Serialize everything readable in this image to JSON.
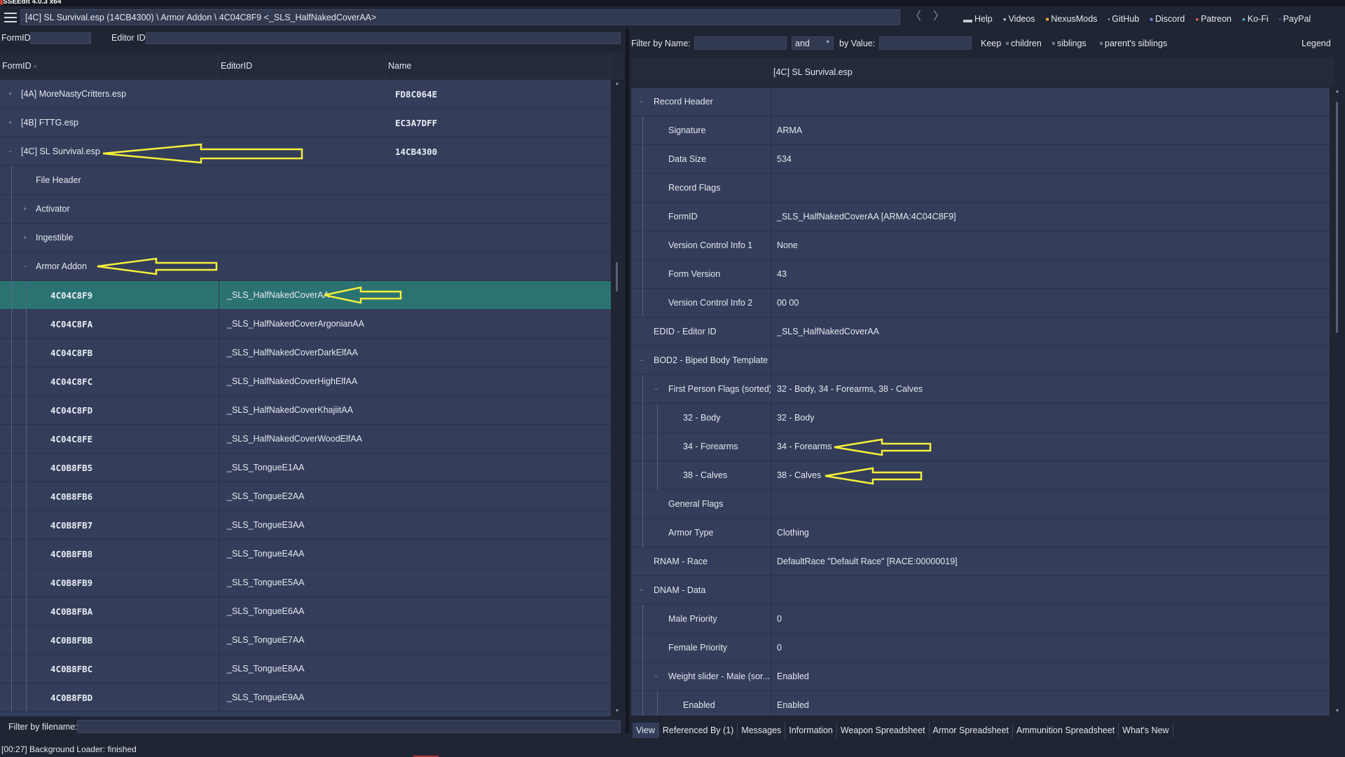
{
  "app": {
    "title": "SSEEdit 4.0.3 x64"
  },
  "toolbar": {
    "path": "[4C] SL Survival.esp (14CB4300) \\ Armor Addon \\ 4C04C8F9 <_SLS_HalfNakedCoverAA>",
    "back_glyph": "〈",
    "forward_glyph": "〉",
    "links": [
      {
        "label": "Help",
        "icon": "book-icon"
      },
      {
        "label": "Videos",
        "icon": "video-icon"
      },
      {
        "label": "NexusMods",
        "icon": "nexus-icon"
      },
      {
        "label": "GitHub",
        "icon": "github-icon"
      },
      {
        "label": "Discord",
        "icon": "discord-icon"
      },
      {
        "label": "Patreon",
        "icon": "patreon-icon"
      },
      {
        "label": "Ko-Fi",
        "icon": "kofi-icon"
      },
      {
        "label": "PayPal",
        "icon": "paypal-icon"
      }
    ]
  },
  "left": {
    "formid_label": "FormID",
    "editorid_label": "Editor ID",
    "formid_value": "",
    "editorid_value": "",
    "columns": {
      "formid": "FormID",
      "editorid": "EditorID",
      "name": "Name"
    },
    "rows": [
      {
        "level": 0,
        "expander": "+",
        "formid": "[4A] MoreNastyCritters.esp",
        "editorid": "",
        "name": "FD8C064E"
      },
      {
        "level": 0,
        "expander": "+",
        "formid": "[4B] FTTG.esp",
        "editorid": "",
        "name": "EC3A7DFF"
      },
      {
        "level": 0,
        "expander": "−",
        "formid": "[4C] SL Survival.esp",
        "editorid": "",
        "name": "14CB4300"
      },
      {
        "level": 1,
        "expander": "",
        "formid": "File Header",
        "editorid": "",
        "name": ""
      },
      {
        "level": 1,
        "expander": "+",
        "formid": "Activator",
        "editorid": "",
        "name": ""
      },
      {
        "level": 1,
        "expander": "+",
        "formid": "Ingestible",
        "editorid": "",
        "name": ""
      },
      {
        "level": 1,
        "expander": "−",
        "formid": "Armor Addon",
        "editorid": "",
        "name": ""
      },
      {
        "level": 2,
        "expander": "",
        "formid": "4C04C8F9",
        "editorid": "_SLS_HalfNakedCoverAA",
        "name": "",
        "selected": true
      },
      {
        "level": 2,
        "expander": "",
        "formid": "4C04C8FA",
        "editorid": "_SLS_HalfNakedCoverArgonianAA",
        "name": ""
      },
      {
        "level": 2,
        "expander": "",
        "formid": "4C04C8FB",
        "editorid": "_SLS_HalfNakedCoverDarkElfAA",
        "name": ""
      },
      {
        "level": 2,
        "expander": "",
        "formid": "4C04C8FC",
        "editorid": "_SLS_HalfNakedCoverHighElfAA",
        "name": ""
      },
      {
        "level": 2,
        "expander": "",
        "formid": "4C04C8FD",
        "editorid": "_SLS_HalfNakedCoverKhajiitAA",
        "name": ""
      },
      {
        "level": 2,
        "expander": "",
        "formid": "4C04C8FE",
        "editorid": "_SLS_HalfNakedCoverWoodElfAA",
        "name": ""
      },
      {
        "level": 2,
        "expander": "",
        "formid": "4C0B8FB5",
        "editorid": "_SLS_TongueE1AA",
        "name": ""
      },
      {
        "level": 2,
        "expander": "",
        "formid": "4C0B8FB6",
        "editorid": "_SLS_TongueE2AA",
        "name": ""
      },
      {
        "level": 2,
        "expander": "",
        "formid": "4C0B8FB7",
        "editorid": "_SLS_TongueE3AA",
        "name": ""
      },
      {
        "level": 2,
        "expander": "",
        "formid": "4C0B8FB8",
        "editorid": "_SLS_TongueE4AA",
        "name": ""
      },
      {
        "level": 2,
        "expander": "",
        "formid": "4C0B8FB9",
        "editorid": "_SLS_TongueE5AA",
        "name": ""
      },
      {
        "level": 2,
        "expander": "",
        "formid": "4C0B8FBA",
        "editorid": "_SLS_TongueE6AA",
        "name": ""
      },
      {
        "level": 2,
        "expander": "",
        "formid": "4C0B8FBB",
        "editorid": "_SLS_TongueE7AA",
        "name": ""
      },
      {
        "level": 2,
        "expander": "",
        "formid": "4C0B8FBC",
        "editorid": "_SLS_TongueE8AA",
        "name": ""
      },
      {
        "level": 2,
        "expander": "",
        "formid": "4C0B8FBD",
        "editorid": "_SLS_TongueE9AA",
        "name": ""
      }
    ],
    "filter_label": "Filter by filename:",
    "filter_value": ""
  },
  "right": {
    "filter_name_label": "Filter by Name:",
    "filter_name_value": "",
    "and_label": "and",
    "by_value_label": "by Value:",
    "by_value_value": "",
    "keep_label": "Keep",
    "keep_options": [
      "children",
      "siblings",
      "parent's siblings"
    ],
    "legend_label": "Legend",
    "file_header": "[4C] SL Survival.esp",
    "rows": [
      {
        "level": 0,
        "expander": "−",
        "key": "Record Header",
        "value": ""
      },
      {
        "level": 1,
        "expander": "",
        "key": "Signature",
        "value": "ARMA"
      },
      {
        "level": 1,
        "expander": "",
        "key": "Data Size",
        "value": "534"
      },
      {
        "level": 1,
        "expander": "",
        "key": "Record Flags",
        "value": ""
      },
      {
        "level": 1,
        "expander": "",
        "key": "FormID",
        "value": "_SLS_HalfNakedCoverAA [ARMA:4C04C8F9]"
      },
      {
        "level": 1,
        "expander": "",
        "key": "Version Control Info 1",
        "value": "None"
      },
      {
        "level": 1,
        "expander": "",
        "key": "Form Version",
        "value": "43"
      },
      {
        "level": 1,
        "expander": "",
        "key": "Version Control Info 2",
        "value": "00 00"
      },
      {
        "level": 0,
        "expander": "",
        "key": "EDID - Editor ID",
        "value": "_SLS_HalfNakedCoverAA"
      },
      {
        "level": 0,
        "expander": "−",
        "key": "BOD2 - Biped Body Template",
        "value": ""
      },
      {
        "level": 1,
        "expander": "−",
        "key": "First Person Flags (sorted)",
        "value": "32 - Body, 34 - Forearms, 38 - Calves"
      },
      {
        "level": 2,
        "expander": "",
        "key": "32 - Body",
        "value": "32 - Body"
      },
      {
        "level": 2,
        "expander": "",
        "key": "34 - Forearms",
        "value": "34 - Forearms"
      },
      {
        "level": 2,
        "expander": "",
        "key": "38 - Calves",
        "value": "38 - Calves"
      },
      {
        "level": 1,
        "expander": "",
        "key": "General Flags",
        "value": ""
      },
      {
        "level": 1,
        "expander": "",
        "key": "Armor Type",
        "value": "Clothing"
      },
      {
        "level": 0,
        "expander": "",
        "key": "RNAM - Race",
        "value": "DefaultRace \"Default Race\" [RACE:00000019]"
      },
      {
        "level": 0,
        "expander": "−",
        "key": "DNAM - Data",
        "value": ""
      },
      {
        "level": 1,
        "expander": "",
        "key": "Male Priority",
        "value": "0"
      },
      {
        "level": 1,
        "expander": "",
        "key": "Female Priority",
        "value": "0"
      },
      {
        "level": 1,
        "expander": "−",
        "key": "Weight slider - Male (sor...",
        "value": "Enabled"
      },
      {
        "level": 2,
        "expander": "",
        "key": "Enabled",
        "value": "Enabled"
      }
    ],
    "tabs": [
      {
        "label": "View",
        "active": true
      },
      {
        "label": "Referenced By (1)"
      },
      {
        "label": "Messages"
      },
      {
        "label": "Information"
      },
      {
        "label": "Weapon Spreadsheet"
      },
      {
        "label": "Armor Spreadsheet"
      },
      {
        "label": "Ammunition Spreadsheet"
      },
      {
        "label": "What's New"
      }
    ]
  },
  "status": {
    "text": "[00:27] Background Loader: finished"
  },
  "colors": {
    "selected_row": "#2b7373",
    "grid_bg": "#343d5a",
    "app_bg": "#1f2533",
    "annotation_arrow": "#f5f03a"
  }
}
